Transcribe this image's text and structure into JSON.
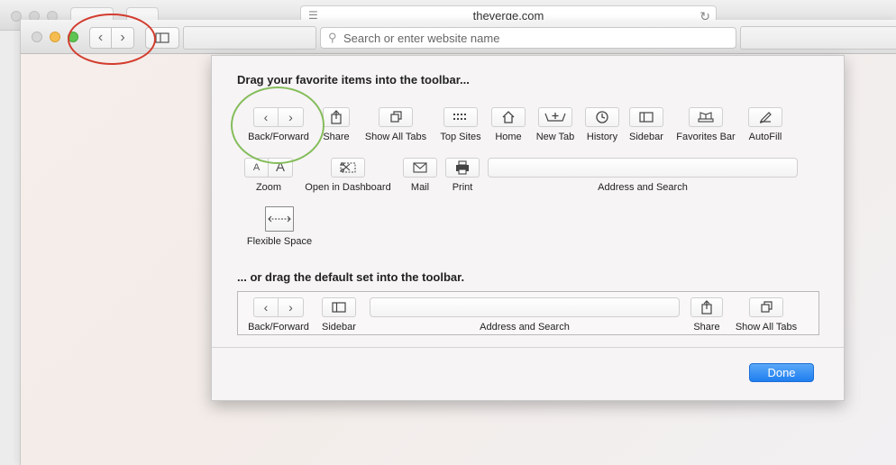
{
  "background_window": {
    "url": "theverge.com"
  },
  "toolbar": {
    "search_placeholder": "Search or enter website name",
    "back_glyph": "‹",
    "forward_glyph": "›"
  },
  "sheet": {
    "heading_items": "Drag your favorite items into the toolbar...",
    "heading_default": "... or drag the default set into the toolbar.",
    "items": [
      {
        "label": "Back/Forward",
        "icon": "back-forward-icon"
      },
      {
        "label": "Share",
        "icon": "share-icon"
      },
      {
        "label": "Show All Tabs",
        "icon": "show-all-tabs-icon"
      },
      {
        "label": "Top Sites",
        "icon": "top-sites-icon"
      },
      {
        "label": "Home",
        "icon": "home-icon"
      },
      {
        "label": "New Tab",
        "icon": "new-tab-icon"
      },
      {
        "label": "History",
        "icon": "history-icon"
      },
      {
        "label": "Sidebar",
        "icon": "sidebar-icon"
      },
      {
        "label": "Favorites Bar",
        "icon": "favorites-bar-icon"
      },
      {
        "label": "AutoFill",
        "icon": "autofill-icon"
      },
      {
        "label": "Zoom",
        "icon": "zoom-icon"
      },
      {
        "label": "Open in Dashboard",
        "icon": "dashboard-icon"
      },
      {
        "label": "Mail",
        "icon": "mail-icon"
      },
      {
        "label": "Print",
        "icon": "print-icon"
      },
      {
        "label": "Address and Search",
        "icon": "address-field"
      },
      {
        "label": "Flexible Space",
        "icon": "flexible-space-icon"
      }
    ],
    "default_set": [
      {
        "label": "Back/Forward"
      },
      {
        "label": "Sidebar"
      },
      {
        "label": "Address and Search"
      },
      {
        "label": "Share"
      },
      {
        "label": "Show All Tabs"
      }
    ],
    "done_label": "Done",
    "zoom_small": "A",
    "zoom_large": "A"
  },
  "colors": {
    "accent": "#1f7ef0",
    "annotation_red": "#d33c2e",
    "annotation_green": "#84bd5a"
  }
}
